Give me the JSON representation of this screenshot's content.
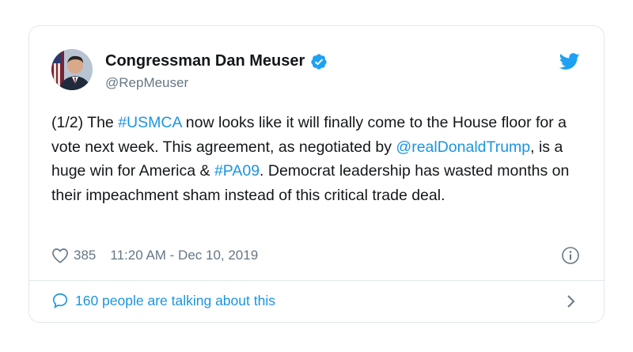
{
  "tweet": {
    "author": {
      "name": "Congressman Dan Meuser",
      "handle": "@RepMeuser",
      "verified": true
    },
    "text_segments": [
      {
        "text": "(1/2) The ",
        "type": "text"
      },
      {
        "text": "#USMCA",
        "type": "link"
      },
      {
        "text": " now looks like it will finally come to the House floor for a vote next week. This agreement, as negotiated by ",
        "type": "text"
      },
      {
        "text": "@realDonaldTrump",
        "type": "link"
      },
      {
        "text": ", is a huge win for America & ",
        "type": "text"
      },
      {
        "text": "#PA09",
        "type": "link"
      },
      {
        "text": ". Democrat leadership has wasted months on their impeachment sham instead of this critical trade deal.",
        "type": "text"
      }
    ],
    "likes": "385",
    "timestamp": "11:20 AM - Dec 10, 2019",
    "talking_text": "160 people are talking about this"
  },
  "icons": {
    "verified": "verified-badge-icon",
    "platform": "twitter-bird-icon",
    "like": "heart-icon",
    "info": "info-icon",
    "reply": "speech-bubble-icon",
    "chevron": "chevron-right-icon"
  },
  "colors": {
    "link": "#1b95e0",
    "text": "#14171a",
    "secondary": "#657786",
    "border": "#e1e8ed",
    "verified": "#1da1f2"
  }
}
